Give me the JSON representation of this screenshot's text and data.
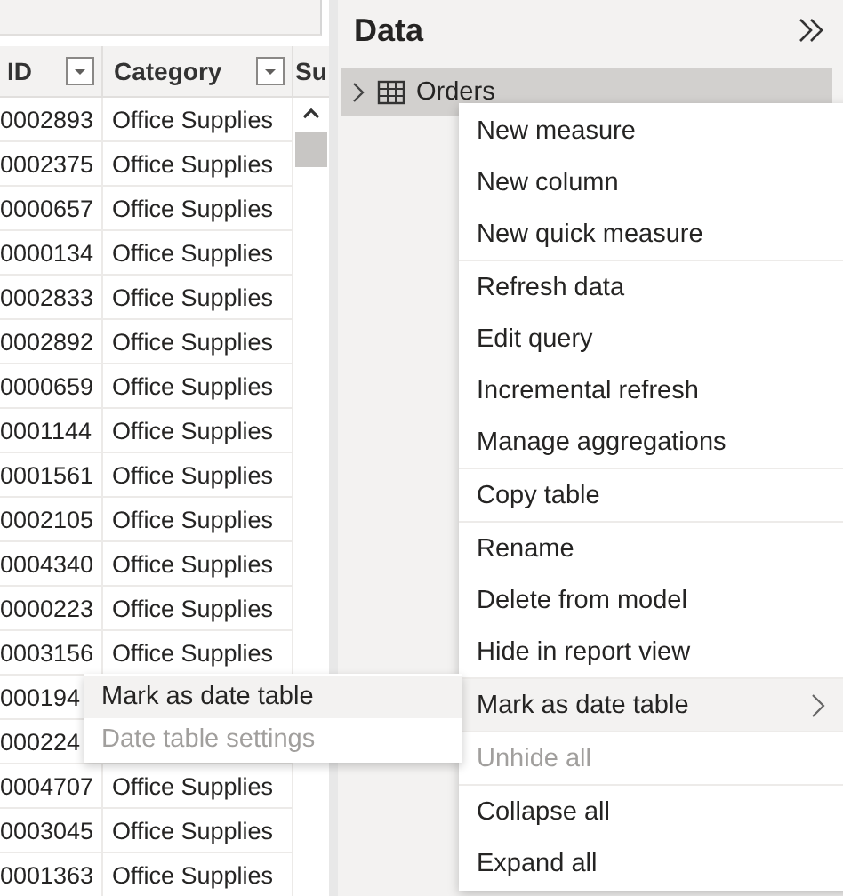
{
  "table": {
    "columns": [
      {
        "label": "ID"
      },
      {
        "label": "Category"
      },
      {
        "label": "Su"
      }
    ],
    "rows": [
      {
        "id": "0002893",
        "category": "Office Supplies"
      },
      {
        "id": "0002375",
        "category": "Office Supplies"
      },
      {
        "id": "0000657",
        "category": "Office Supplies"
      },
      {
        "id": "0000134",
        "category": "Office Supplies"
      },
      {
        "id": "0002833",
        "category": "Office Supplies"
      },
      {
        "id": "0002892",
        "category": "Office Supplies"
      },
      {
        "id": "0000659",
        "category": "Office Supplies"
      },
      {
        "id": "0001144",
        "category": "Office Supplies"
      },
      {
        "id": "0001561",
        "category": "Office Supplies"
      },
      {
        "id": "0002105",
        "category": "Office Supplies"
      },
      {
        "id": "0004340",
        "category": "Office Supplies"
      },
      {
        "id": "0000223",
        "category": "Office Supplies"
      },
      {
        "id": "0003156",
        "category": "Office Supplies"
      },
      {
        "id": "000194"
      },
      {
        "id": "000224"
      },
      {
        "id": "0004707",
        "category": "Office Supplies"
      },
      {
        "id": "0003045",
        "category": "Office Supplies"
      },
      {
        "id": "0001363",
        "category": "Office Supplies"
      }
    ]
  },
  "data_pane": {
    "title": "Data",
    "tree": [
      {
        "label": "Orders",
        "expanded": false,
        "selected": true
      }
    ]
  },
  "context_menu": {
    "groups": [
      [
        {
          "label": "New measure",
          "disabled": false,
          "highlighted": false,
          "has_submenu": false
        },
        {
          "label": "New column",
          "disabled": false,
          "highlighted": false,
          "has_submenu": false
        },
        {
          "label": "New quick measure",
          "disabled": false,
          "highlighted": false,
          "has_submenu": false
        }
      ],
      [
        {
          "label": "Refresh data",
          "disabled": false,
          "highlighted": false,
          "has_submenu": false
        },
        {
          "label": "Edit query",
          "disabled": false,
          "highlighted": false,
          "has_submenu": false
        },
        {
          "label": "Incremental refresh",
          "disabled": false,
          "highlighted": false,
          "has_submenu": false
        },
        {
          "label": "Manage aggregations",
          "disabled": false,
          "highlighted": false,
          "has_submenu": false
        }
      ],
      [
        {
          "label": "Copy table",
          "disabled": false,
          "highlighted": false,
          "has_submenu": false
        }
      ],
      [
        {
          "label": "Rename",
          "disabled": false,
          "highlighted": false,
          "has_submenu": false
        },
        {
          "label": "Delete from model",
          "disabled": false,
          "highlighted": false,
          "has_submenu": false
        },
        {
          "label": "Hide in report view",
          "disabled": false,
          "highlighted": false,
          "has_submenu": false
        }
      ],
      [
        {
          "label": "Mark as date table",
          "disabled": false,
          "highlighted": true,
          "has_submenu": true
        }
      ],
      [
        {
          "label": "Unhide all",
          "disabled": true,
          "highlighted": false,
          "has_submenu": false
        }
      ],
      [
        {
          "label": "Collapse all",
          "disabled": false,
          "highlighted": false,
          "has_submenu": false
        },
        {
          "label": "Expand all",
          "disabled": false,
          "highlighted": false,
          "has_submenu": false
        }
      ]
    ]
  },
  "submenu": {
    "items": [
      {
        "label": "Mark as date table",
        "disabled": false,
        "highlighted": true
      },
      {
        "label": "Date table settings",
        "disabled": true,
        "highlighted": false
      }
    ]
  }
}
